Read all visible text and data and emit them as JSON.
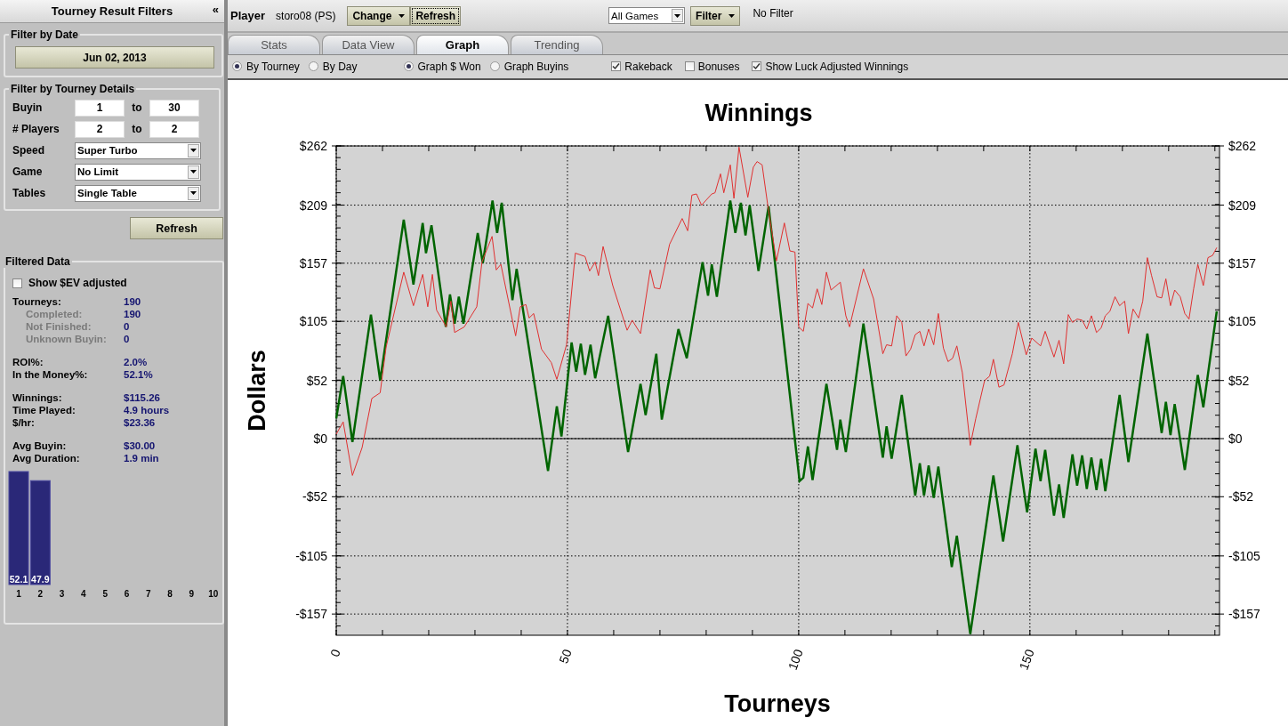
{
  "sidebar": {
    "title": "Tourney Result Filters",
    "collapse": "«",
    "date_group": {
      "title": "Filter by Date",
      "date": "Jun 02, 2013"
    },
    "details_group": {
      "title": "Filter by Tourney Details",
      "rows": [
        {
          "kind": "range",
          "label": "Buyin",
          "from": "1",
          "to_label": "to",
          "to": "30"
        },
        {
          "kind": "range",
          "label": "# Players",
          "from": "2",
          "to_label": "to",
          "to": "2"
        },
        {
          "kind": "select",
          "label": "Speed",
          "value": "Super Turbo"
        },
        {
          "kind": "select",
          "label": "Game",
          "value": "No Limit"
        },
        {
          "kind": "select",
          "label": "Tables",
          "value": "Single Table"
        }
      ]
    },
    "refresh": "Refresh",
    "data_group": {
      "title": "Filtered Data",
      "ev_checkbox": {
        "label": "Show $EV adjusted",
        "checked": false
      },
      "stat_groups": [
        [
          {
            "label": "Tourneys:",
            "value": "190",
            "sub": false
          },
          {
            "label": "Completed:",
            "value": "190",
            "sub": true
          },
          {
            "label": "Not Finished:",
            "value": "0",
            "sub": true
          },
          {
            "label": "Unknown Buyin:",
            "value": "0",
            "sub": true
          }
        ],
        [
          {
            "label": "ROI%:",
            "value": "2.0%",
            "sub": false
          },
          {
            "label": "In the Money%:",
            "value": "52.1%",
            "sub": false
          }
        ],
        [
          {
            "label": "Winnings:",
            "value": "$115.26",
            "sub": false
          },
          {
            "label": "Time Played:",
            "value": "4.9 hours",
            "sub": false
          },
          {
            "label": "$/hr:",
            "value": "$23.36",
            "sub": false
          }
        ],
        [
          {
            "label": "Avg Buyin:",
            "value": "$30.00",
            "sub": false
          },
          {
            "label": "Avg Duration:",
            "value": "1.9 min",
            "sub": false
          }
        ]
      ],
      "chart_data": {
        "type": "bar",
        "categories": [
          "1",
          "2",
          "3",
          "4",
          "5",
          "6",
          "7",
          "8",
          "9",
          "10"
        ],
        "values": [
          52.1,
          47.9,
          null,
          null,
          null,
          null,
          null,
          null,
          null,
          null
        ],
        "data_labels": true
      }
    }
  },
  "toolbar": {
    "player_label": "Player",
    "player": "storo08 (PS)",
    "change": "Change",
    "refresh": "Refresh",
    "refresh_focused": true,
    "games": "All Games",
    "filter": "Filter",
    "filter_status": "No Filter"
  },
  "tabs": [
    {
      "label": "Stats",
      "selected": false
    },
    {
      "label": "Data View",
      "selected": false
    },
    {
      "label": "Graph",
      "selected": true
    },
    {
      "label": "Trending",
      "selected": false
    }
  ],
  "options": {
    "x_mode": [
      {
        "label": "By Tourney",
        "selected": true
      },
      {
        "label": "By Day",
        "selected": false
      }
    ],
    "y_mode": [
      {
        "label": "Graph $ Won",
        "selected": true
      },
      {
        "label": "Graph Buyins",
        "selected": false
      }
    ],
    "checkboxes": [
      {
        "label": "Rakeback",
        "checked": true
      },
      {
        "label": "Bonuses",
        "checked": false
      },
      {
        "label": "Show Luck Adjusted Winnings",
        "checked": true
      }
    ]
  },
  "graph": {
    "right_axis_labels": [
      "$262",
      "$209",
      "$157",
      "$105",
      "$52",
      "$0",
      "-$52",
      "-$105",
      "-$157"
    ],
    "chart_data": {
      "type": "line",
      "title": "Winnings",
      "xlabel": "Tourneys",
      "ylabel": "Dollars",
      "xlim": [
        0,
        191
      ],
      "ylim": [
        -176,
        262
      ],
      "xticks": [
        0,
        50,
        100,
        150
      ],
      "grid": true,
      "yticks": [
        {
          "value": 262,
          "label": "$262"
        },
        {
          "value": 209,
          "label": "$209"
        },
        {
          "value": 157,
          "label": "$157"
        },
        {
          "value": 105,
          "label": "$105"
        },
        {
          "value": 52,
          "label": "$52"
        },
        {
          "value": 0,
          "label": "$0"
        },
        {
          "value": -52,
          "label": "-$52"
        },
        {
          "value": -105,
          "label": "-$105"
        },
        {
          "value": -157,
          "label": "-$157"
        }
      ],
      "series": [
        {
          "color": "#006400",
          "x": [
            0,
            1.5,
            3.5,
            7.5,
            9.5,
            14.6,
            16.7,
            18.7,
            19.4,
            20.6,
            23.7,
            24.6,
            25.6,
            26.5,
            27.5,
            30.6,
            31.7,
            33.8,
            34.8,
            35.8,
            38.1,
            39,
            45.8,
            47.7,
            48.7,
            50.9,
            51.9,
            52.9,
            53.8,
            55,
            56,
            58.8,
            63.1,
            65.8,
            66.9,
            69.2,
            70.4,
            74,
            75.8,
            79.2,
            80.4,
            81.2,
            82.3,
            85.2,
            86.3,
            87.5,
            88.5,
            89.4,
            91.3,
            93.5,
            100.2,
            101,
            102,
            103,
            106,
            108.3,
            109,
            110.2,
            114,
            118.2,
            119,
            120.1,
            122.3,
            125.2,
            126.2,
            127.1,
            128.1,
            129.2,
            130.2,
            133.1,
            134.2,
            137.1,
            142.1,
            144.2,
            147.3,
            149.4,
            151.2,
            152.3,
            153.3,
            155.2,
            156.3,
            157.3,
            159.2,
            160.2,
            161.3,
            162.3,
            163.3,
            164.4,
            165.4,
            166.3,
            169.4,
            171.3,
            175.4,
            178.5,
            179.4,
            180.4,
            181.3,
            183.5,
            186.3,
            187.5,
            190.4
          ],
          "values": [
            18,
            56,
            -3,
            111,
            52,
            196,
            138,
            193,
            166,
            191,
            100,
            129,
            103,
            127,
            103,
            184,
            157,
            213,
            184,
            211,
            124,
            152,
            -29,
            29,
            2,
            86,
            60,
            85,
            57,
            84,
            54,
            110,
            -12,
            49,
            21,
            76,
            17,
            98,
            72,
            158,
            128,
            156,
            127,
            213,
            184,
            211,
            182,
            209,
            150,
            208,
            -38,
            -35,
            -7,
            -37,
            49,
            -10,
            17,
            -12,
            103,
            -17,
            11,
            -18,
            39,
            -51,
            -22,
            -51,
            -24,
            -53,
            -25,
            -115,
            -87,
            -175,
            -33,
            -92,
            -6,
            -66,
            -9,
            -38,
            -10,
            -69,
            -41,
            -71,
            -14,
            -42,
            -15,
            -45,
            -17,
            -46,
            -18,
            -47,
            39,
            -21,
            94,
            5,
            33,
            3,
            31,
            -28,
            57,
            28,
            114
          ]
        },
        {
          "color": "#e03030",
          "x": [
            0,
            1.5,
            3.5,
            5.6,
            7.7,
            9.5,
            10.8,
            14.6,
            16.7,
            18.7,
            19.8,
            20.8,
            21.7,
            23.8,
            24.8,
            25.6,
            27.7,
            30.4,
            31.5,
            33.7,
            34.6,
            35.6,
            38.8,
            39.8,
            41,
            41.7,
            42.7,
            44.4,
            46.5,
            47.7,
            49.8,
            51.7,
            53.8,
            54.8,
            56,
            56.7,
            57.7,
            59.8,
            62.9,
            64,
            65.8,
            67.9,
            68.8,
            70,
            72.1,
            74.8,
            76,
            76.9,
            77.9,
            79,
            81.2,
            81.9,
            83.1,
            83.8,
            85.2,
            86,
            87.1,
            89,
            90.2,
            91,
            92.1,
            93.3,
            95.2,
            96.9,
            98.1,
            99.2,
            100,
            101,
            102,
            103,
            104,
            105,
            106,
            107,
            109,
            110.2,
            111,
            114,
            116.2,
            118.2,
            119,
            120.1,
            121.2,
            122.3,
            123.2,
            124.2,
            125.2,
            126.2,
            127.1,
            128.1,
            129.2,
            130.2,
            131.3,
            132.3,
            133.3,
            134.2,
            135.4,
            137.1,
            138.3,
            140.2,
            141.3,
            142.1,
            143.3,
            144.4,
            146.2,
            147.5,
            149.2,
            150.4,
            152.3,
            153.3,
            155.2,
            156.3,
            157.3,
            158.3,
            159.2,
            160.2,
            161.3,
            162.3,
            163.3,
            164.4,
            165.4,
            166.3,
            167.3,
            168.4,
            169.4,
            170.5,
            171.3,
            172.3,
            173.5,
            174.4,
            175.4,
            176.3,
            177.5,
            178.5,
            179.4,
            180.4,
            181.3,
            182.5,
            183.5,
            184.4,
            185.4,
            186.3,
            187.5,
            188.5,
            189.5,
            190.4
          ],
          "values": [
            4,
            15,
            -33,
            -8,
            36,
            41,
            82,
            149,
            119,
            147,
            118,
            147,
            115,
            100,
            123,
            95,
            100,
            118,
            158,
            181,
            151,
            156,
            92,
            118,
            120,
            108,
            112,
            80,
            68,
            53,
            84,
            166,
            163,
            150,
            158,
            146,
            172,
            137,
            97,
            106,
            94,
            151,
            135,
            134,
            174,
            197,
            186,
            218,
            219,
            209,
            219,
            220,
            237,
            220,
            245,
            215,
            261,
            216,
            243,
            248,
            245,
            209,
            159,
            193,
            168,
            167,
            100,
            96,
            121,
            117,
            134,
            120,
            149,
            133,
            140,
            110,
            100,
            152,
            125,
            76,
            84,
            83,
            110,
            104,
            74,
            80,
            93,
            96,
            83,
            98,
            84,
            112,
            81,
            69,
            72,
            83,
            59,
            -6,
            18,
            52,
            56,
            71,
            46,
            48,
            76,
            104,
            75,
            90,
            83,
            96,
            73,
            88,
            67,
            111,
            104,
            107,
            106,
            98,
            110,
            95,
            99,
            110,
            114,
            127,
            119,
            123,
            94,
            116,
            108,
            123,
            162,
            146,
            127,
            126,
            143,
            119,
            133,
            127,
            112,
            107,
            134,
            156,
            137,
            162,
            164,
            171
          ]
        }
      ]
    }
  }
}
